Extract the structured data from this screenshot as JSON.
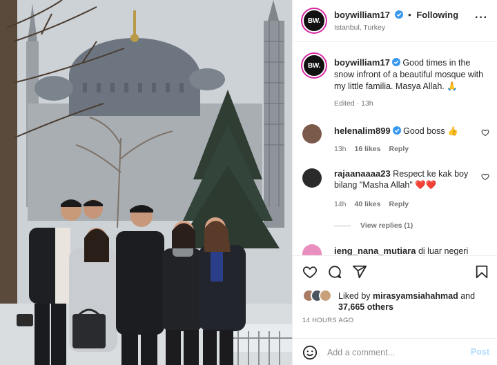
{
  "post": {
    "username": "boywilliam17",
    "avatar_initials": "BW.",
    "follow_status": "Following",
    "location": "Istanbul, Turkey",
    "more_icon": "more-options-icon"
  },
  "caption": {
    "username": "boywilliam17",
    "text": "Good times in the snow infront of a beautiful mosque with my little familia. Masya Allah. 🙏",
    "meta": "Edited · 13h"
  },
  "comments": [
    {
      "username": "helenalim899",
      "text": "Good boss 👍",
      "time": "13h",
      "likes": "16 likes",
      "reply": "Reply",
      "avatar_color": "#7a5a4a",
      "verified": true
    },
    {
      "username": "rajaanaaaa23",
      "text": "Respect ke kak boy bilang \"Masha Allah\" ❤️❤️",
      "time": "14h",
      "likes": "40 likes",
      "reply": "Reply",
      "avatar_color": "#2a2a2a",
      "verified": false
    },
    {
      "username": "ieng_nana_mutiara",
      "text": "di luar negeri",
      "avatar_color": "#e88fc0"
    }
  ],
  "view_replies": "View replies (1)",
  "actions": {
    "like_icon": "heart-icon",
    "comment_icon": "comment-icon",
    "share_icon": "share-icon",
    "save_icon": "bookmark-icon"
  },
  "likes": {
    "prefix": "Liked by",
    "user": "mirasyamsiahahmad",
    "and": "and",
    "others": "37,665 others"
  },
  "time_ago": "14 HOURS AGO",
  "add_comment": {
    "placeholder": "Add a comment...",
    "post_label": "Post"
  },
  "colors": {
    "verified": "#3897f0",
    "post_disabled": "#b3dbff",
    "story_ring": "#d6249f"
  }
}
